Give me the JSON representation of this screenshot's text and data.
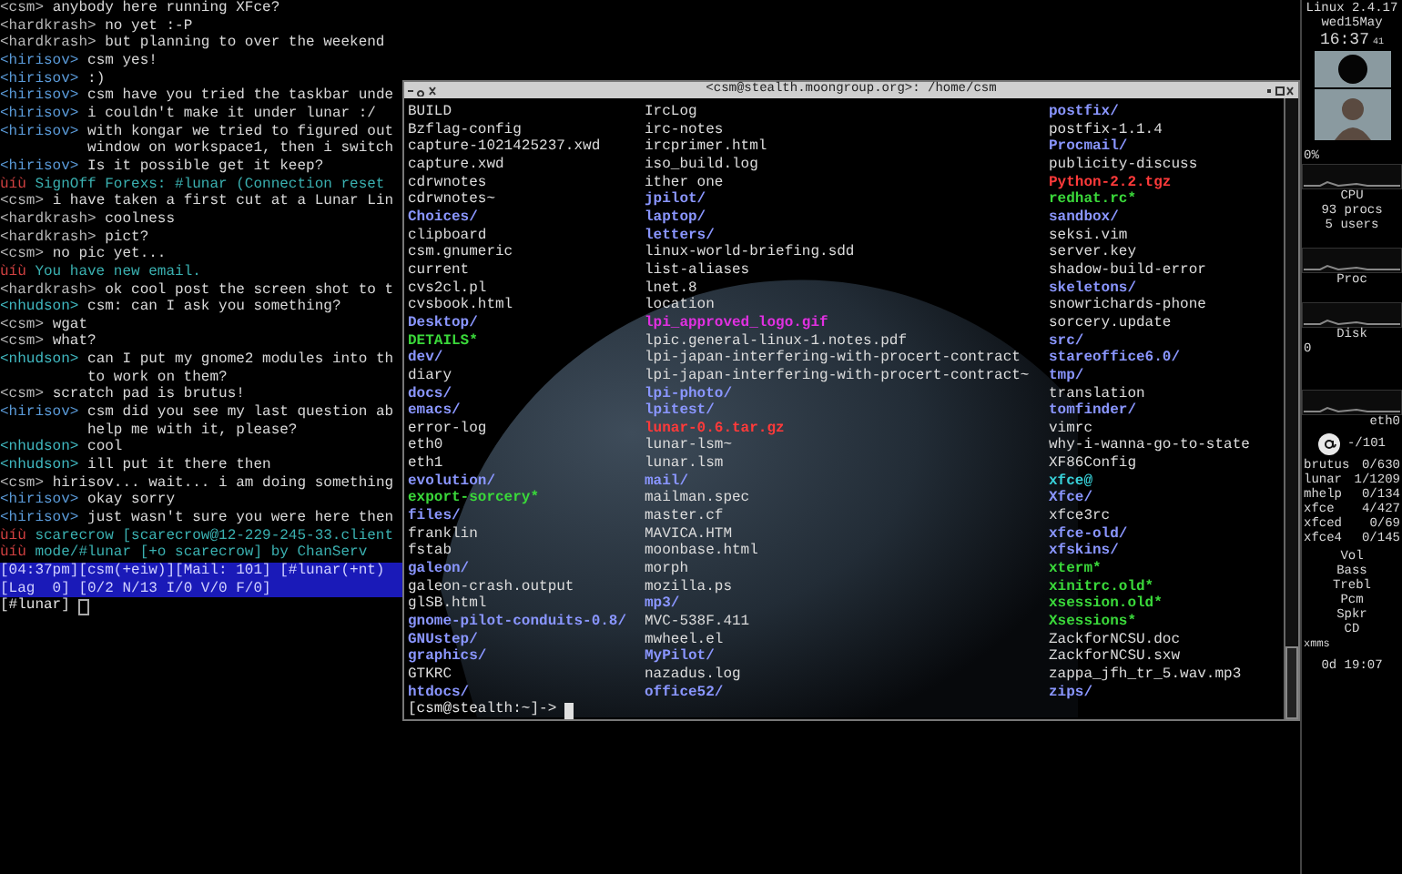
{
  "chat": {
    "lines": [
      {
        "kind": "message",
        "nick": "<csm>",
        "color": "#b8b8b8",
        "text": "anybody here running XFce?"
      },
      {
        "kind": "message",
        "nick": "<hardkrash>",
        "color": "#b8b8b8",
        "text": "no yet :-P"
      },
      {
        "kind": "message",
        "nick": "<hardkrash>",
        "color": "#b8b8b8",
        "text": "but planning to over the weekend"
      },
      {
        "kind": "message",
        "nick": "<hirisov>",
        "color": "#5a9ad8",
        "text": "csm yes!"
      },
      {
        "kind": "message",
        "nick": "<hirisov>",
        "color": "#5a9ad8",
        "text": ":)"
      },
      {
        "kind": "message",
        "nick": "<hirisov>",
        "color": "#5a9ad8",
        "text": "csm have you tried the taskbar unde"
      },
      {
        "kind": "message",
        "nick": "<hirisov>",
        "color": "#5a9ad8",
        "text": "i couldn't make it under lunar :/"
      },
      {
        "kind": "message",
        "nick": "<hirisov>",
        "color": "#5a9ad8",
        "text": "with kongar we tried to figured out"
      },
      {
        "kind": "continuation",
        "text": "window on workspace1, then i switch"
      },
      {
        "kind": "message",
        "nick": "<hirisov>",
        "color": "#5a9ad8",
        "text": "Is it possible get it keep?"
      },
      {
        "kind": "notice",
        "nick": "ùíù",
        "color": "#d04040",
        "text": "SignOff Forexs: #lunar (Connection reset"
      },
      {
        "kind": "message",
        "nick": "<csm>",
        "color": "#b8b8b8",
        "text": "i have taken a first cut at a Lunar Lin"
      },
      {
        "kind": "message",
        "nick": "<hardkrash>",
        "color": "#b8b8b8",
        "text": "coolness"
      },
      {
        "kind": "message",
        "nick": "<hardkrash>",
        "color": "#b8b8b8",
        "text": "pict?"
      },
      {
        "kind": "message",
        "nick": "<csm>",
        "color": "#b8b8b8",
        "text": "no pic yet..."
      },
      {
        "kind": "notice",
        "nick": "ùíù",
        "color": "#d04040",
        "text": "You have new email."
      },
      {
        "kind": "message",
        "nick": "<hardkrash>",
        "color": "#b8b8b8",
        "text": "ok cool post the screen shot to t"
      },
      {
        "kind": "message",
        "nick": "<nhudson>",
        "color": "#40b8c0",
        "text": "csm: can I ask you something?"
      },
      {
        "kind": "message",
        "nick": "<csm>",
        "color": "#b8b8b8",
        "text": "wgat"
      },
      {
        "kind": "message",
        "nick": "<csm>",
        "color": "#b8b8b8",
        "text": "what?"
      },
      {
        "kind": "message",
        "nick": "<nhudson>",
        "color": "#40b8c0",
        "text": "can I put my gnome2 modules into th"
      },
      {
        "kind": "continuation",
        "text": "to work on them?"
      },
      {
        "kind": "message",
        "nick": "<csm>",
        "color": "#b8b8b8",
        "text": "scratch pad is brutus!"
      },
      {
        "kind": "message",
        "nick": "<hirisov>",
        "color": "#5a9ad8",
        "text": "csm did you see my last question ab"
      },
      {
        "kind": "continuation",
        "text": "help me with it, please?"
      },
      {
        "kind": "message",
        "nick": "<nhudson>",
        "color": "#40b8c0",
        "text": "cool"
      },
      {
        "kind": "message",
        "nick": "<nhudson>",
        "color": "#40b8c0",
        "text": "ill put it there then"
      },
      {
        "kind": "message",
        "nick": "<csm>",
        "color": "#b8b8b8",
        "text": "hirisov... wait... i am doing something"
      },
      {
        "kind": "message",
        "nick": "<hirisov>",
        "color": "#5a9ad8",
        "text": "okay sorry"
      },
      {
        "kind": "message",
        "nick": "<hirisov>",
        "color": "#5a9ad8",
        "text": "just wasn't sure you were here then"
      },
      {
        "kind": "notice",
        "nick": "ùíù",
        "color": "#d04040",
        "text": "scarecrow [scarecrow@12-229-245-33.client"
      },
      {
        "kind": "notice",
        "nick": "ùíù",
        "color": "#d04040",
        "text": "mode/#lunar [+o scarecrow] by ChanServ"
      }
    ],
    "status_bar": [
      "[04:37pm][csm(+eiw)][Mail: 101] [#lunar(+nt)",
      "[Lag  0] [0/2 N/13 I/0 V/0 F/0]"
    ],
    "input": "[#lunar]"
  },
  "terminal": {
    "title": "<csm@stealth.moongroup.org>: /home/csm",
    "columns": [
      [
        {
          "kind": "file",
          "text": "BUILD"
        },
        {
          "kind": "file",
          "text": "Bzflag-config"
        },
        {
          "kind": "file",
          "text": "capture-1021425237.xwd"
        },
        {
          "kind": "file",
          "text": "capture.xwd"
        },
        {
          "kind": "file",
          "text": "cdrwnotes"
        },
        {
          "kind": "file",
          "text": "cdrwnotes~"
        },
        {
          "kind": "dir",
          "text": "Choices/"
        },
        {
          "kind": "file",
          "text": "clipboard"
        },
        {
          "kind": "file",
          "text": "csm.gnumeric"
        },
        {
          "kind": "file",
          "text": "current"
        },
        {
          "kind": "file",
          "text": "cvs2cl.pl"
        },
        {
          "kind": "file",
          "text": "cvsbook.html"
        },
        {
          "kind": "dir",
          "text": "Desktop/"
        },
        {
          "kind": "exec",
          "text": "DETAILS*"
        },
        {
          "kind": "dir",
          "text": "dev/"
        },
        {
          "kind": "file",
          "text": "diary"
        },
        {
          "kind": "dir",
          "text": "docs/"
        },
        {
          "kind": "dir",
          "text": "emacs/"
        },
        {
          "kind": "file",
          "text": "error-log"
        },
        {
          "kind": "file",
          "text": "eth0"
        },
        {
          "kind": "file",
          "text": "eth1"
        },
        {
          "kind": "dir",
          "text": "evolution/"
        },
        {
          "kind": "exec",
          "text": "export-sorcery*"
        },
        {
          "kind": "dir",
          "text": "files/"
        },
        {
          "kind": "file",
          "text": "franklin"
        },
        {
          "kind": "file",
          "text": "fstab"
        },
        {
          "kind": "dir",
          "text": "galeon/"
        },
        {
          "kind": "file",
          "text": "galeon-crash.output"
        },
        {
          "kind": "file",
          "text": "glSB.html"
        },
        {
          "kind": "dir",
          "text": "gnome-pilot-conduits-0.8/"
        },
        {
          "kind": "dir",
          "text": "GNUstep/"
        },
        {
          "kind": "dir",
          "text": "graphics/"
        },
        {
          "kind": "file",
          "text": "GTKRC"
        },
        {
          "kind": "dir",
          "text": "htdocs/"
        }
      ],
      [
        {
          "kind": "file",
          "text": "IrcLog"
        },
        {
          "kind": "file",
          "text": "irc-notes"
        },
        {
          "kind": "file",
          "text": "ircprimer.html"
        },
        {
          "kind": "file",
          "text": "iso_build.log"
        },
        {
          "kind": "file",
          "text": "ither one"
        },
        {
          "kind": "dir",
          "text": "jpilot/"
        },
        {
          "kind": "dir",
          "text": "laptop/"
        },
        {
          "kind": "dir",
          "text": "letters/"
        },
        {
          "kind": "file",
          "text": "linux-world-briefing.sdd"
        },
        {
          "kind": "file",
          "text": "list-aliases"
        },
        {
          "kind": "file",
          "text": "lnet.8"
        },
        {
          "kind": "file",
          "text": "location"
        },
        {
          "kind": "image",
          "text": "lpi_approved_logo.gif"
        },
        {
          "kind": "file",
          "text": "lpic.general-linux-1.notes.pdf"
        },
        {
          "kind": "file",
          "text": "lpi-japan-interfering-with-procert-contract"
        },
        {
          "kind": "file",
          "text": "lpi-japan-interfering-with-procert-contract~"
        },
        {
          "kind": "dir",
          "text": "lpi-photo/"
        },
        {
          "kind": "dir",
          "text": "lpitest/"
        },
        {
          "kind": "archive",
          "text": "lunar-0.6.tar.gz"
        },
        {
          "kind": "file",
          "text": "lunar-lsm~"
        },
        {
          "kind": "file",
          "text": "lunar.lsm"
        },
        {
          "kind": "dir",
          "text": "mail/"
        },
        {
          "kind": "file",
          "text": "mailman.spec"
        },
        {
          "kind": "file",
          "text": "master.cf"
        },
        {
          "kind": "file",
          "text": "MAVICA.HTM"
        },
        {
          "kind": "file",
          "text": "moonbase.html"
        },
        {
          "kind": "file",
          "text": "morph"
        },
        {
          "kind": "file",
          "text": "mozilla.ps"
        },
        {
          "kind": "dir",
          "text": "mp3/"
        },
        {
          "kind": "file",
          "text": "MVC-538F.411"
        },
        {
          "kind": "file",
          "text": "mwheel.el"
        },
        {
          "kind": "dir",
          "text": "MyPilot/"
        },
        {
          "kind": "file",
          "text": "nazadus.log"
        },
        {
          "kind": "dir",
          "text": "office52/"
        }
      ],
      [
        {
          "kind": "dir",
          "text": "postfix/"
        },
        {
          "kind": "file",
          "text": "postfix-1.1.4"
        },
        {
          "kind": "dir",
          "text": "Procmail/"
        },
        {
          "kind": "file",
          "text": "publicity-discuss"
        },
        {
          "kind": "archive",
          "text": "Python-2.2.tgz"
        },
        {
          "kind": "exec",
          "text": "redhat.rc*"
        },
        {
          "kind": "dir",
          "text": "sandbox/"
        },
        {
          "kind": "file",
          "text": "seksi.vim"
        },
        {
          "kind": "file",
          "text": "server.key"
        },
        {
          "kind": "file",
          "text": "shadow-build-error"
        },
        {
          "kind": "dir",
          "text": "skeletons/"
        },
        {
          "kind": "file",
          "text": "snowrichards-phone"
        },
        {
          "kind": "file",
          "text": "sorcery.update"
        },
        {
          "kind": "dir",
          "text": "src/"
        },
        {
          "kind": "dir",
          "text": "stareoffice6.0/"
        },
        {
          "kind": "dir",
          "text": "tmp/"
        },
        {
          "kind": "file",
          "text": "translation"
        },
        {
          "kind": "dir",
          "text": "tomfinder/"
        },
        {
          "kind": "file",
          "text": "vimrc"
        },
        {
          "kind": "file",
          "text": "why-i-wanna-go-to-state"
        },
        {
          "kind": "file",
          "text": "XF86Config"
        },
        {
          "kind": "link",
          "text": "xfce@"
        },
        {
          "kind": "dir",
          "text": "Xfce/"
        },
        {
          "kind": "file",
          "text": "xfce3rc"
        },
        {
          "kind": "dir",
          "text": "xfce-old/"
        },
        {
          "kind": "dir",
          "text": "xfskins/"
        },
        {
          "kind": "exec",
          "text": "xterm*"
        },
        {
          "kind": "exec",
          "text": "xinitrc.old*"
        },
        {
          "kind": "exec",
          "text": "xsession.old*"
        },
        {
          "kind": "exec",
          "text": "Xsessions*"
        },
        {
          "kind": "file",
          "text": "ZackforNCSU.doc"
        },
        {
          "kind": "file",
          "text": "ZackforNCSU.sxw"
        },
        {
          "kind": "file",
          "text": "zappa_jfh_tr_5.wav.mp3"
        },
        {
          "kind": "dir",
          "text": "zips/"
        }
      ]
    ],
    "prompt": "[csm@stealth:~]->"
  },
  "monitor": {
    "system": "Linux 2.4.17",
    "date": "wed15May",
    "time": "16:37",
    "seconds": "41",
    "cpu_percent": "0%",
    "cpu_label": "CPU",
    "procs": "93 procs",
    "users": "5 users",
    "proc_label": "Proc",
    "disk_label": "Disk",
    "disk_value": "0",
    "net_label": "eth0",
    "mail_count": "-/101",
    "mailboxes": [
      {
        "name": "brutus",
        "count": "0/630"
      },
      {
        "name": "lunar",
        "count": "1/1209"
      },
      {
        "name": "mhelp",
        "count": "0/134"
      },
      {
        "name": "xfce",
        "count": "4/427"
      },
      {
        "name": "xfced",
        "count": "0/69"
      },
      {
        "name": "xfce4",
        "count": "0/145"
      }
    ],
    "mixer": [
      "Vol",
      "Bass",
      "Trebl",
      "Pcm",
      "Spkr",
      "CD"
    ],
    "player": "xmms",
    "uptime": "0d 19:07"
  }
}
